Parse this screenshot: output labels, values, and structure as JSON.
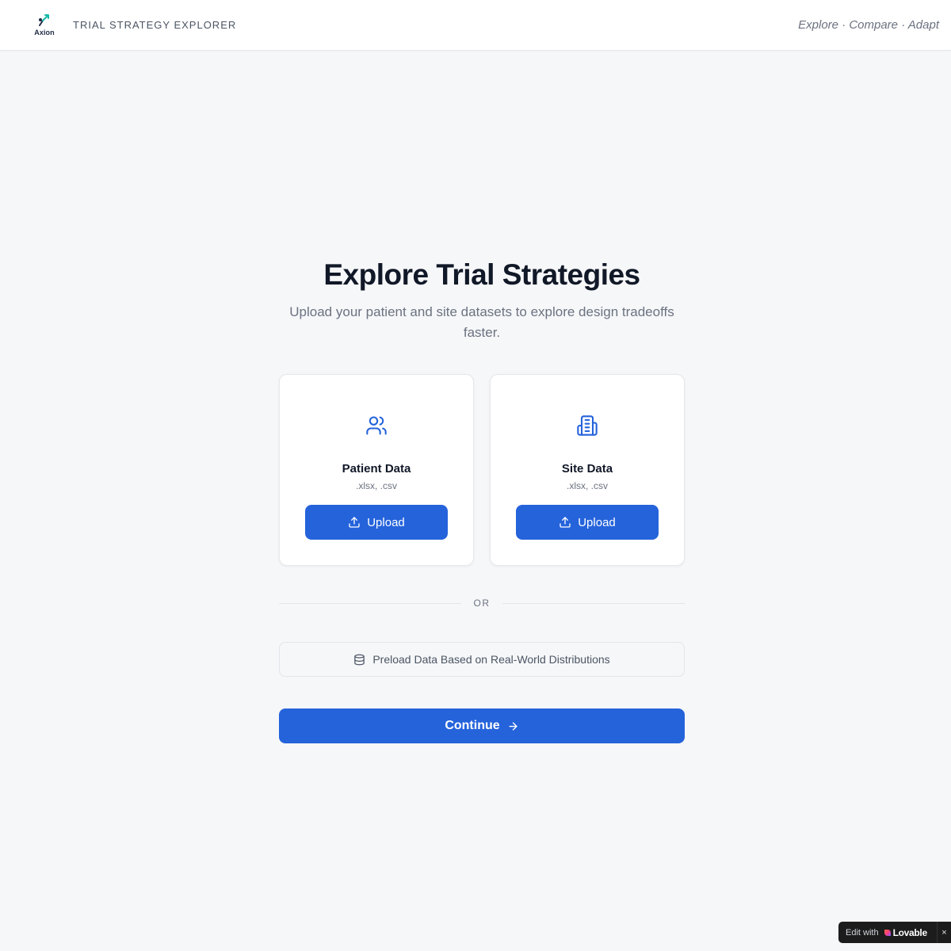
{
  "header": {
    "logo_text": "Axion",
    "app_title": "TRIAL STRATEGY EXPLORER",
    "tagline": "Explore · Compare · Adapt"
  },
  "hero": {
    "title": "Explore Trial Strategies",
    "subtitle": "Upload your patient and site datasets to explore design tradeoffs faster."
  },
  "cards": [
    {
      "title": "Patient Data",
      "formats": ".xlsx, .csv",
      "button_label": "Upload",
      "icon": "users-icon"
    },
    {
      "title": "Site Data",
      "formats": ".xlsx, .csv",
      "button_label": "Upload",
      "icon": "building-icon"
    }
  ],
  "divider": {
    "label": "OR"
  },
  "preload": {
    "label": "Preload Data Based on Real-World Distributions",
    "icon": "database-icon"
  },
  "continue": {
    "label": "Continue",
    "icon": "arrow-right-icon"
  },
  "badge": {
    "prefix": "Edit with",
    "brand": "Lovable",
    "close": "×"
  },
  "colors": {
    "accent": "#2563db",
    "background": "#f6f7f9",
    "text": "#111827",
    "muted": "#6b7280"
  }
}
